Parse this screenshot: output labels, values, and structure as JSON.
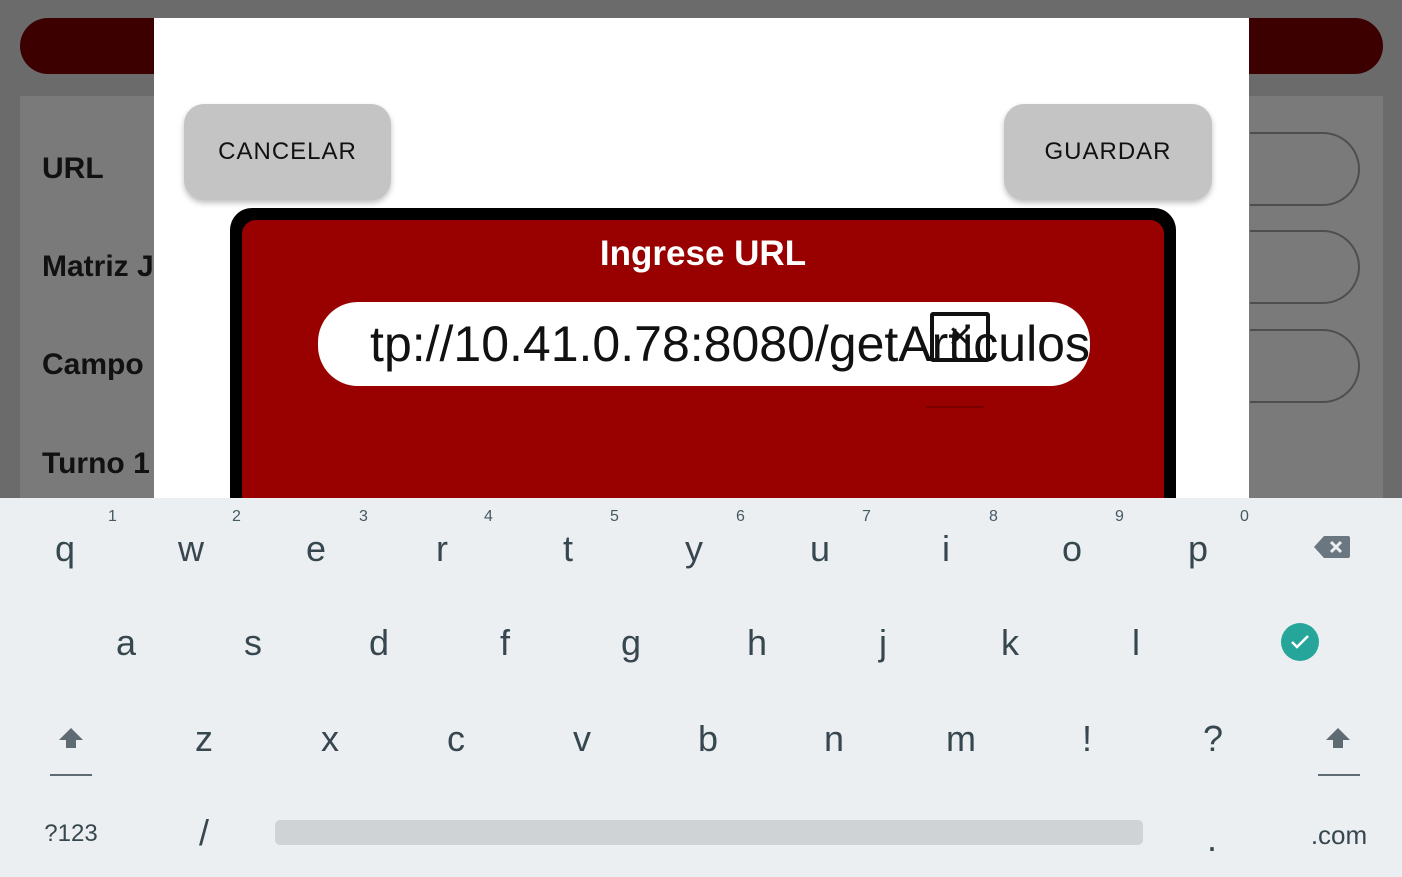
{
  "background": {
    "labels": [
      "URL",
      "Matriz J",
      "Campo",
      "Turno 1"
    ]
  },
  "dialog": {
    "cancel_label": "CANCELAR",
    "save_label": "GUARDAR",
    "url_title": "Ingrese URL",
    "url_value": "tp://10.41.0.78:8080/getArticulos",
    "clear_icon": "clear-text-icon"
  },
  "keyboard": {
    "row1": [
      {
        "key": "q",
        "hint": "1"
      },
      {
        "key": "w",
        "hint": "2"
      },
      {
        "key": "e",
        "hint": "3"
      },
      {
        "key": "r",
        "hint": "4"
      },
      {
        "key": "t",
        "hint": "5"
      },
      {
        "key": "y",
        "hint": "6"
      },
      {
        "key": "u",
        "hint": "7"
      },
      {
        "key": "i",
        "hint": "8"
      },
      {
        "key": "o",
        "hint": "9"
      },
      {
        "key": "p",
        "hint": "0"
      }
    ],
    "row2": [
      "a",
      "s",
      "d",
      "f",
      "g",
      "h",
      "j",
      "k",
      "l"
    ],
    "row3": [
      "z",
      "x",
      "c",
      "v",
      "b",
      "n",
      "m",
      "!",
      "?"
    ],
    "row4": {
      "symbols": "?123",
      "slash": "/",
      "period": ".",
      "dotcom": ".com"
    },
    "icons": {
      "backspace": "backspace-icon",
      "done": "checkmark-icon",
      "shift": "shift-icon"
    },
    "accent_color": "#26a69a"
  },
  "colors": {
    "brand_red": "#990000",
    "button_gray": "#c4c4c4"
  }
}
